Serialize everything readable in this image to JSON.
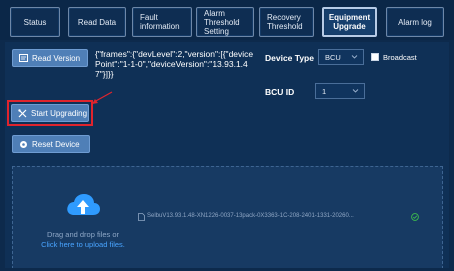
{
  "tabs": [
    {
      "label": "Status",
      "active": false
    },
    {
      "label": "Read Data",
      "active": false
    },
    {
      "label": "Fault information",
      "active": false
    },
    {
      "label": "Alarm Threshold Setting",
      "active": false
    },
    {
      "label": "Recovery Threshold",
      "active": false
    },
    {
      "label": "Equipment Upgrade",
      "active": true
    },
    {
      "label": "Alarm log",
      "active": false
    }
  ],
  "actions": {
    "read_version": "Read Version",
    "start_upgrading": "Start Upgrading",
    "reset_device": "Reset Device"
  },
  "version_output": "{\"frames\":{\"devLevel\":2,\"version\":[{\"devicePoint\":\"1-1-0\",\"deviceVersion\":\"13.93.1.47\"}]}}",
  "device_type": {
    "label": "Device Type",
    "value": "BCU",
    "broadcast_label": "Broadcast",
    "broadcast_checked": false
  },
  "bcu_id": {
    "label": "BCU ID",
    "value": "1"
  },
  "upload": {
    "prompt": "Drag and drop files or",
    "link": "Click here to upload files.",
    "file_name": "SelbuV13.93.1.48-XN1226-0037-13pack-0X3363-1C-208-2401-1331-20260...",
    "file_status": "uploaded"
  },
  "colors": {
    "accent_button": "#4f7fb7",
    "highlight": "#e0242d",
    "upload_icon": "#2f9bff",
    "success": "#3dbd4e"
  }
}
